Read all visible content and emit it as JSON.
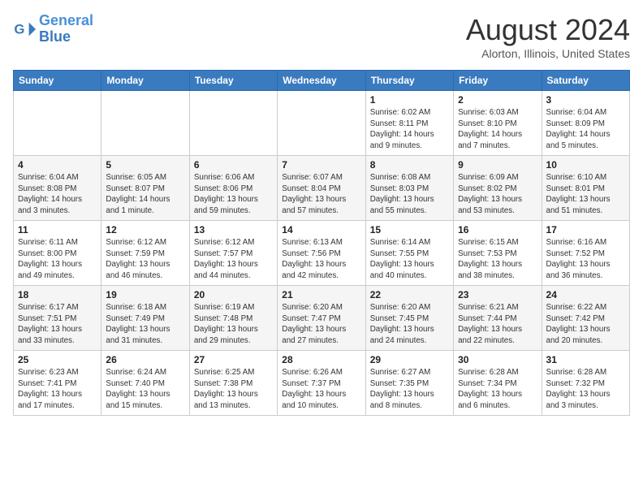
{
  "logo": {
    "line1": "General",
    "line2": "Blue"
  },
  "title": "August 2024",
  "subtitle": "Alorton, Illinois, United States",
  "days_of_week": [
    "Sunday",
    "Monday",
    "Tuesday",
    "Wednesday",
    "Thursday",
    "Friday",
    "Saturday"
  ],
  "weeks": [
    [
      {
        "num": "",
        "info": ""
      },
      {
        "num": "",
        "info": ""
      },
      {
        "num": "",
        "info": ""
      },
      {
        "num": "",
        "info": ""
      },
      {
        "num": "1",
        "info": "Sunrise: 6:02 AM\nSunset: 8:11 PM\nDaylight: 14 hours\nand 9 minutes."
      },
      {
        "num": "2",
        "info": "Sunrise: 6:03 AM\nSunset: 8:10 PM\nDaylight: 14 hours\nand 7 minutes."
      },
      {
        "num": "3",
        "info": "Sunrise: 6:04 AM\nSunset: 8:09 PM\nDaylight: 14 hours\nand 5 minutes."
      }
    ],
    [
      {
        "num": "4",
        "info": "Sunrise: 6:04 AM\nSunset: 8:08 PM\nDaylight: 14 hours\nand 3 minutes."
      },
      {
        "num": "5",
        "info": "Sunrise: 6:05 AM\nSunset: 8:07 PM\nDaylight: 14 hours\nand 1 minute."
      },
      {
        "num": "6",
        "info": "Sunrise: 6:06 AM\nSunset: 8:06 PM\nDaylight: 13 hours\nand 59 minutes."
      },
      {
        "num": "7",
        "info": "Sunrise: 6:07 AM\nSunset: 8:04 PM\nDaylight: 13 hours\nand 57 minutes."
      },
      {
        "num": "8",
        "info": "Sunrise: 6:08 AM\nSunset: 8:03 PM\nDaylight: 13 hours\nand 55 minutes."
      },
      {
        "num": "9",
        "info": "Sunrise: 6:09 AM\nSunset: 8:02 PM\nDaylight: 13 hours\nand 53 minutes."
      },
      {
        "num": "10",
        "info": "Sunrise: 6:10 AM\nSunset: 8:01 PM\nDaylight: 13 hours\nand 51 minutes."
      }
    ],
    [
      {
        "num": "11",
        "info": "Sunrise: 6:11 AM\nSunset: 8:00 PM\nDaylight: 13 hours\nand 49 minutes."
      },
      {
        "num": "12",
        "info": "Sunrise: 6:12 AM\nSunset: 7:59 PM\nDaylight: 13 hours\nand 46 minutes."
      },
      {
        "num": "13",
        "info": "Sunrise: 6:12 AM\nSunset: 7:57 PM\nDaylight: 13 hours\nand 44 minutes."
      },
      {
        "num": "14",
        "info": "Sunrise: 6:13 AM\nSunset: 7:56 PM\nDaylight: 13 hours\nand 42 minutes."
      },
      {
        "num": "15",
        "info": "Sunrise: 6:14 AM\nSunset: 7:55 PM\nDaylight: 13 hours\nand 40 minutes."
      },
      {
        "num": "16",
        "info": "Sunrise: 6:15 AM\nSunset: 7:53 PM\nDaylight: 13 hours\nand 38 minutes."
      },
      {
        "num": "17",
        "info": "Sunrise: 6:16 AM\nSunset: 7:52 PM\nDaylight: 13 hours\nand 36 minutes."
      }
    ],
    [
      {
        "num": "18",
        "info": "Sunrise: 6:17 AM\nSunset: 7:51 PM\nDaylight: 13 hours\nand 33 minutes."
      },
      {
        "num": "19",
        "info": "Sunrise: 6:18 AM\nSunset: 7:49 PM\nDaylight: 13 hours\nand 31 minutes."
      },
      {
        "num": "20",
        "info": "Sunrise: 6:19 AM\nSunset: 7:48 PM\nDaylight: 13 hours\nand 29 minutes."
      },
      {
        "num": "21",
        "info": "Sunrise: 6:20 AM\nSunset: 7:47 PM\nDaylight: 13 hours\nand 27 minutes."
      },
      {
        "num": "22",
        "info": "Sunrise: 6:20 AM\nSunset: 7:45 PM\nDaylight: 13 hours\nand 24 minutes."
      },
      {
        "num": "23",
        "info": "Sunrise: 6:21 AM\nSunset: 7:44 PM\nDaylight: 13 hours\nand 22 minutes."
      },
      {
        "num": "24",
        "info": "Sunrise: 6:22 AM\nSunset: 7:42 PM\nDaylight: 13 hours\nand 20 minutes."
      }
    ],
    [
      {
        "num": "25",
        "info": "Sunrise: 6:23 AM\nSunset: 7:41 PM\nDaylight: 13 hours\nand 17 minutes."
      },
      {
        "num": "26",
        "info": "Sunrise: 6:24 AM\nSunset: 7:40 PM\nDaylight: 13 hours\nand 15 minutes."
      },
      {
        "num": "27",
        "info": "Sunrise: 6:25 AM\nSunset: 7:38 PM\nDaylight: 13 hours\nand 13 minutes."
      },
      {
        "num": "28",
        "info": "Sunrise: 6:26 AM\nSunset: 7:37 PM\nDaylight: 13 hours\nand 10 minutes."
      },
      {
        "num": "29",
        "info": "Sunrise: 6:27 AM\nSunset: 7:35 PM\nDaylight: 13 hours\nand 8 minutes."
      },
      {
        "num": "30",
        "info": "Sunrise: 6:28 AM\nSunset: 7:34 PM\nDaylight: 13 hours\nand 6 minutes."
      },
      {
        "num": "31",
        "info": "Sunrise: 6:28 AM\nSunset: 7:32 PM\nDaylight: 13 hours\nand 3 minutes."
      }
    ]
  ]
}
